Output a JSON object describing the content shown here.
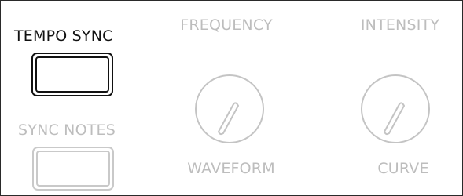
{
  "tempo_sync": {
    "label": "TEMPO SYNC",
    "state": "active"
  },
  "sync_notes": {
    "label": "SYNC NOTES",
    "state": "disabled"
  },
  "frequency": {
    "top_label": "FREQUENCY",
    "bottom_label": "WAVEFORM",
    "state": "disabled"
  },
  "intensity": {
    "top_label": "INTENSITY",
    "bottom_label": "CURVE",
    "state": "disabled"
  },
  "colors": {
    "active": "#111111",
    "disabled": "#bdbdbd",
    "border": "#2a2a2a",
    "background": "#ffffff"
  },
  "icons": {
    "knob": "rotary-knob-icon"
  }
}
